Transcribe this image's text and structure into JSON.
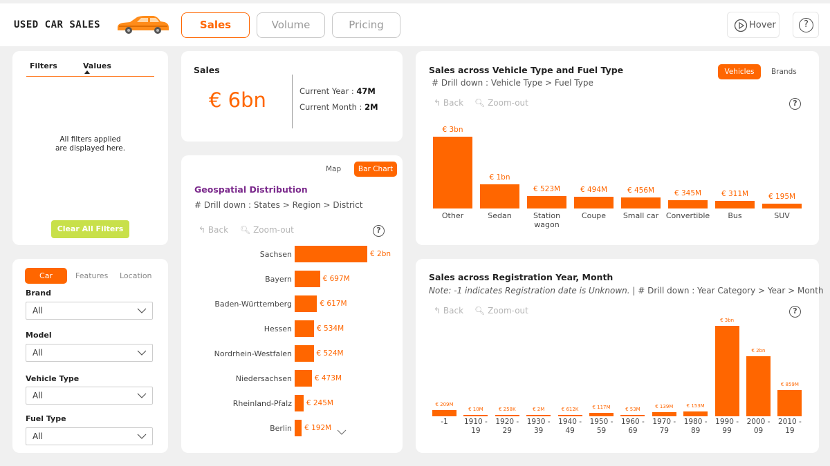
{
  "header": {
    "title": "USED CAR SALES",
    "tabs": [
      {
        "label": "Sales",
        "active": true
      },
      {
        "label": "Volume",
        "active": false
      },
      {
        "label": "Pricing",
        "active": false
      }
    ],
    "hover_label": "Hover",
    "help": "?"
  },
  "filters_panel": {
    "col_filters": "Filters",
    "col_values": "Values",
    "empty_line1": "All filters applied",
    "empty_line2": "are displayed here.",
    "clear_button": "Clear All Filters"
  },
  "slicer_panel": {
    "tabs": [
      {
        "label": "Car",
        "active": true
      },
      {
        "label": "Features",
        "active": false
      },
      {
        "label": "Location",
        "active": false
      }
    ],
    "fields": [
      {
        "label": "Brand",
        "value": "All"
      },
      {
        "label": "Model",
        "value": "All"
      },
      {
        "label": "Vehicle Type",
        "value": "All"
      },
      {
        "label": "Fuel Type",
        "value": "All"
      }
    ]
  },
  "sales_kpi": {
    "title": "Sales",
    "value": "€ 6bn",
    "current_year_label": "Current Year :",
    "current_year_value": "47M",
    "current_month_label": "Current Month :",
    "current_month_value": "2M"
  },
  "geo": {
    "toggle_map": "Map",
    "toggle_bar": "Bar Chart",
    "title": "Geospatial Distribution",
    "subtitle": "# Drill down : States > Region > District",
    "back": "Back",
    "zoom_out": "Zoom-out"
  },
  "vehicle_chart": {
    "title": "Sales across Vehicle Type and Fuel Type",
    "subtitle": "# Drill down : Vehicle Type > Fuel Type",
    "toggle_vehicles": "Vehicles",
    "toggle_brands": "Brands",
    "back": "Back",
    "zoom_out": "Zoom-out"
  },
  "year_chart": {
    "title": "Sales across Registration Year, Month",
    "note": "Note: -1 indicates Registration date is Unknown.",
    "drill": "| # Drill down : Year Category > Year > Month",
    "back": "Back",
    "zoom_out": "Zoom-out"
  },
  "colors": {
    "accent": "#ff6600",
    "clear_button": "#c8e04a",
    "geo_title": "#7b2a8c"
  },
  "chart_data": [
    {
      "type": "bar",
      "orientation": "vertical",
      "title": "Sales across Vehicle Type and Fuel Type",
      "categories": [
        "Other",
        "Sedan",
        "Station wagon",
        "Coupe",
        "Small car",
        "Convertible",
        "Bus",
        "SUV"
      ],
      "values": [
        3000,
        1000,
        523,
        494,
        456,
        345,
        311,
        195
      ],
      "unit": "€M",
      "data_labels": [
        "€ 3bn",
        "€ 1bn",
        "€ 523M",
        "€ 494M",
        "€ 456M",
        "€ 345M",
        "€ 311M",
        "€ 195M"
      ]
    },
    {
      "type": "bar",
      "orientation": "horizontal",
      "title": "Geospatial Distribution",
      "categories": [
        "Sachsen",
        "Bayern",
        "Baden-Württemberg",
        "Hessen",
        "Nordrhein-Westfalen",
        "Niedersachsen",
        "Rheinland-Pfalz",
        "Berlin"
      ],
      "values": [
        2000,
        697,
        617,
        534,
        524,
        473,
        245,
        192
      ],
      "unit": "€M",
      "data_labels": [
        "€ 2bn",
        "€ 697M",
        "€ 617M",
        "€ 534M",
        "€ 524M",
        "€ 473M",
        "€ 245M",
        "€ 192M"
      ]
    },
    {
      "type": "bar",
      "orientation": "vertical",
      "title": "Sales across Registration Year, Month",
      "categories": [
        "-1",
        "1910 - 19",
        "1920 - 29",
        "1930 - 39",
        "1940 - 49",
        "1950 - 59",
        "1960 - 69",
        "1970 - 79",
        "1980 - 89",
        "1990 - 99",
        "2000 - 09",
        "2010 - 19"
      ],
      "values": [
        209,
        0.01,
        0.258,
        2,
        0.612,
        117,
        53,
        139,
        153,
        3000,
        2000,
        859
      ],
      "unit": "€M",
      "data_labels": [
        "€ 209M",
        "€ 10M",
        "€ 258K",
        "€ 2M",
        "€ 612K",
        "€ 117M",
        "€ 53M",
        "€ 139M",
        "€ 153M",
        "€ 3bn",
        "€ 2bn",
        "€ 859M"
      ]
    }
  ]
}
